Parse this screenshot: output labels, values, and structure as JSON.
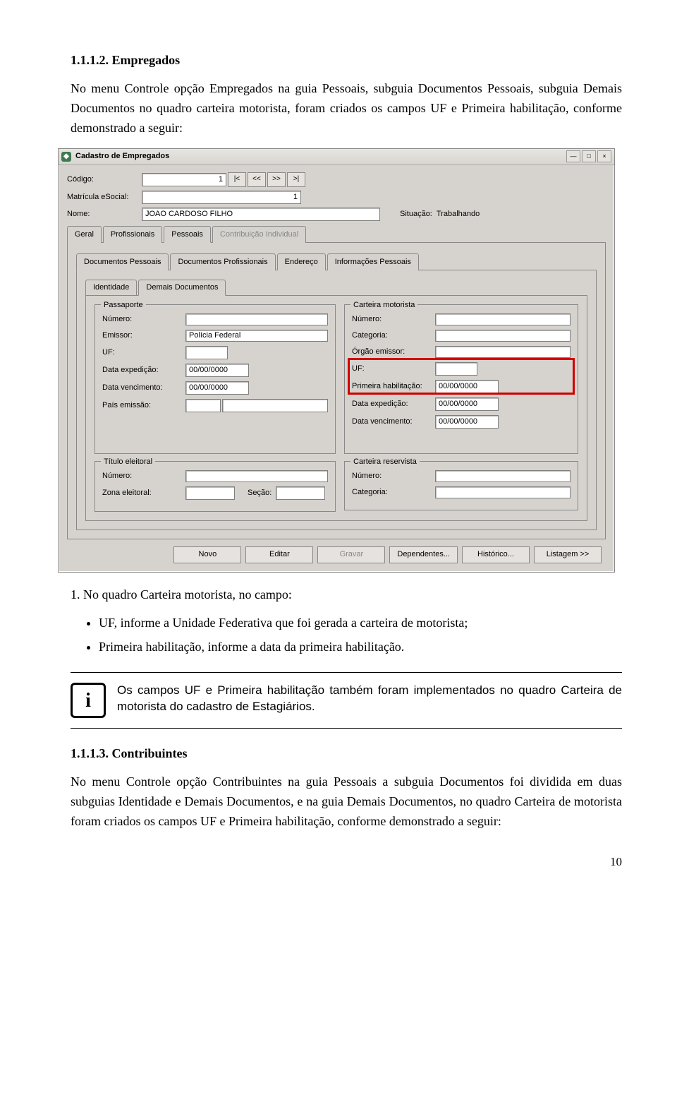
{
  "doc": {
    "s1_num": "1.1.1.2. Empregados",
    "s1_p": "No menu Controle opção Empregados na guia Pessoais, subguia Documentos Pessoais, subguia Demais Documentos no quadro carteira motorista, foram criados os campos UF e Primeira habilitação, conforme demonstrado a seguir:",
    "list_intro_num": "1.",
    "list_intro": "No quadro Carteira motorista, no campo:",
    "li1": "UF, informe a Unidade Federativa que foi gerada a carteira de motorista;",
    "li2": "Primeira habilitação, informe a data da primeira habilitação.",
    "note_text": "Os campos UF e Primeira habilitação também foram implementados no quadro Carteira de motorista do cadastro de Estagiários.",
    "s2_num": "1.1.1.3. Contribuintes",
    "s2_p": "No menu Controle opção Contribuintes na guia Pessoais a subguia Documentos foi dividida em duas subguias Identidade e Demais Documentos, e na guia Demais Documentos, no quadro Carteira de motorista foram criados os campos UF e Primeira habilitação, conforme demonstrado a seguir:",
    "page_number": "10"
  },
  "app": {
    "title": "Cadastro de Empregados",
    "labels": {
      "codigo": "Código:",
      "matricula": "Matrícula eSocial:",
      "nome": "Nome:",
      "situacao_lbl": "Situação:",
      "situacao_val": "Trabalhando"
    },
    "values": {
      "codigo": "1",
      "matricula": "1",
      "nome": "JOAO CARDOSO FILHO"
    },
    "nav": {
      "first": "|<",
      "prev": "<<",
      "next": ">>",
      "last": ">|"
    },
    "tabs": {
      "t1": "Geral",
      "t2": "Profissionais",
      "t3": "Pessoais",
      "t4": "Contribuição Individual"
    },
    "subtabs": {
      "s1": "Documentos Pessoais",
      "s2": "Documentos Profissionais",
      "s3": "Endereço",
      "s4": "Informações Pessoais"
    },
    "minitabs": {
      "m1": "Identidade",
      "m2": "Demais Documentos"
    },
    "passaporte": {
      "legend": "Passaporte",
      "numero": "Número:",
      "emissor": "Emissor:",
      "emissor_val": "Polícia Federal",
      "uf": "UF:",
      "data_exp": "Data expedição:",
      "data_exp_val": "00/00/0000",
      "data_venc": "Data vencimento:",
      "data_venc_val": "00/00/0000",
      "pais": "País emissão:"
    },
    "carteira": {
      "legend": "Carteira motorista",
      "numero": "Número:",
      "categoria": "Categoria:",
      "orgao": "Órgão emissor:",
      "uf": "UF:",
      "prim_hab": "Primeira habilitação:",
      "prim_hab_val": "00/00/0000",
      "data_exp": "Data expedição:",
      "data_exp_val": "00/00/0000",
      "data_venc": "Data vencimento:",
      "data_venc_val": "00/00/0000"
    },
    "titulo": {
      "legend": "Título eleitoral",
      "numero": "Número:",
      "zona": "Zona eleitoral:",
      "secao": "Seção:"
    },
    "reservista": {
      "legend": "Carteira reservista",
      "numero": "Número:",
      "categoria": "Categoria:"
    },
    "buttons": {
      "novo": "Novo",
      "editar": "Editar",
      "gravar": "Gravar",
      "dependentes": "Dependentes...",
      "historico": "Histórico...",
      "listagem": "Listagem >>"
    }
  }
}
